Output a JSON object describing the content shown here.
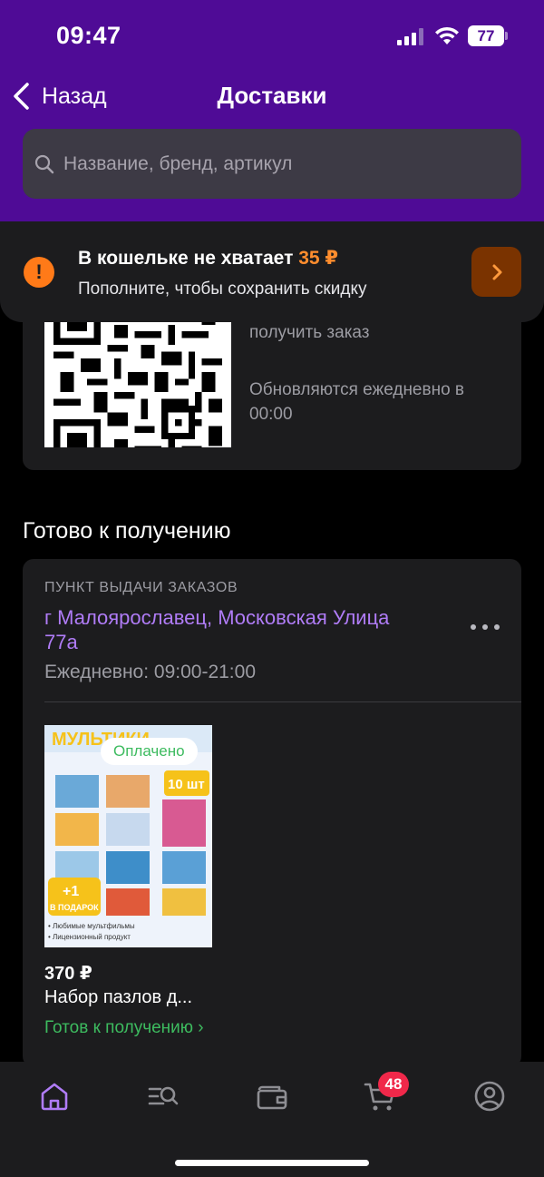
{
  "status_bar": {
    "time": "09:47",
    "battery": "77"
  },
  "nav": {
    "back_label": "Назад",
    "title": "Доставки"
  },
  "search": {
    "placeholder": "Название, бренд, артикул"
  },
  "wallet_banner": {
    "title": "В кошельке не хватает",
    "amount": "35 ₽",
    "subtitle": "Пополните, чтобы сохранить скидку",
    "accent_color": "#ff7a18"
  },
  "qr_card": {
    "text_line1": "получить заказ",
    "text_line2": "Обновляются ежедневно в 00:00"
  },
  "section": {
    "title": "Готово к получению"
  },
  "pickup": {
    "label": "ПУНКТ ВЫДАЧИ ЗАКАЗОВ",
    "address": "г Малоярославец, Московская Улица 77а",
    "hours": "Ежедневно: 09:00-21:00"
  },
  "product": {
    "badge": "Оплачено",
    "price": "370 ₽",
    "name": "Набор пазлов д...",
    "status": "Готов к получению ›",
    "image_banner": "МУЛЬТИКИ",
    "image_count": "10 шт",
    "image_gift_1": "+1",
    "image_gift_2": "В ПОДАРОК",
    "image_note1": "• Любимые мультфильмы",
    "image_note2": "• Лицензионный продукт"
  },
  "tabbar": {
    "items": [
      {
        "icon": "home-icon",
        "active": true
      },
      {
        "icon": "search-catalog-icon",
        "active": false
      },
      {
        "icon": "wallet-icon",
        "active": false
      },
      {
        "icon": "cart-icon",
        "active": false
      },
      {
        "icon": "profile-icon",
        "active": false
      }
    ],
    "cart_badge": "48"
  },
  "colors": {
    "header": "#4f0b96",
    "accent_purple": "#b07cf7",
    "success": "#3dbb5f",
    "badge": "#f0284a"
  }
}
